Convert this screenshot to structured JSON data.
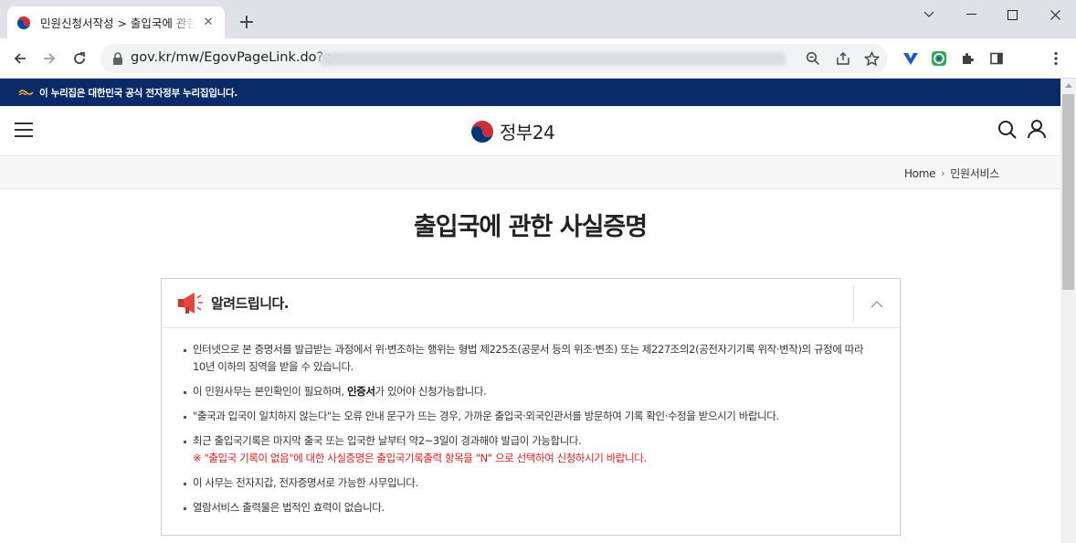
{
  "browser": {
    "tab_title": "민원신청서작성 > 출입국에 관한 사실증명",
    "tab_close": "✕",
    "new_tab": "+",
    "url": "gov.kr/mw/EgovPageLink.do?q="
  },
  "site": {
    "banner_text": "이 누리집은 대한민국 공식 전자정부 누리집입니다.",
    "logo_text": "정부24",
    "breadcrumbs": [
      "Home",
      "민원서비스"
    ],
    "breadcrumb_sep": "›"
  },
  "page": {
    "title": "출입국에 관한 사실증명"
  },
  "notice": {
    "title": "알려드립니다.",
    "items": [
      {
        "text": "인터넷으로 본 증명서를 발급받는 과정에서 위·변조하는 행위는 형법 제225조(공문서 등의 위조·변조) 또는 제227조의2(공전자기기록 위작·변작)의 규정에 따라 10년 이하의 징역을 받을 수 있습니다."
      },
      {
        "text_before": "이 민원사무는 본인확인이 필요하며, ",
        "bold": "인증서",
        "text_after": "가 있어야 신청가능합니다."
      },
      {
        "text": "\"출국과 입국이 일치하지 않는다\"는 오류 안내 문구가 뜨는 경우, 가까운 출입국·외국인관서를 방문하여 기록 확인·수정을 받으시기 바랍니다."
      },
      {
        "text": "최근 출입국기록은 마지막 출국 또는 입국한 날부터 약2~3일이 경과해야 발급이 가능합니다.",
        "warning": "※ \"출입국 기록이 없음\"에 대한 사실증명은 출입국기록출력 항목을 \"N\" 으로 선택하여 신청하시기 바랍니다."
      },
      {
        "text": "이 사무는 전자지갑, 전자증명서로 가능한 사무입니다."
      },
      {
        "text": "열람서비스 출력물은 법적인 효력이 없습니다."
      }
    ]
  },
  "colors": {
    "banner_bg": "#0b2a67",
    "warning_red": "#e02020",
    "tabstrip_bg": "#dee1e6"
  },
  "icons": [
    "taegeuk-favicon-icon",
    "close-icon",
    "plus-icon",
    "minimize-icon",
    "maximize-icon",
    "window-close-icon",
    "chevron-down-icon",
    "back-arrow-icon",
    "forward-arrow-icon",
    "reload-icon",
    "lock-icon",
    "zoom-icon",
    "share-icon",
    "star-icon",
    "extension-icon",
    "sidepanel-icon",
    "kebab-menu-icon",
    "hamburger-icon",
    "search-icon",
    "user-icon",
    "megaphone-icon",
    "chevron-up-icon"
  ]
}
